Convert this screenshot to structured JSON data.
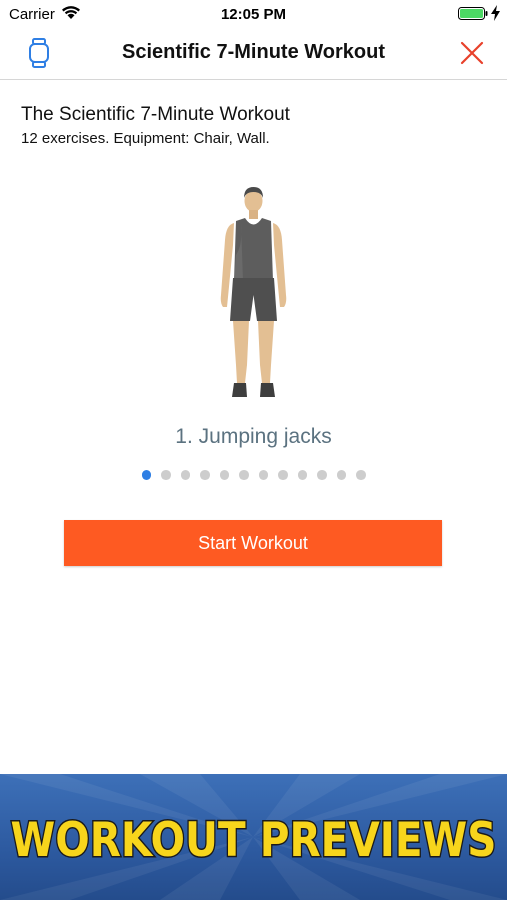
{
  "status_bar": {
    "carrier": "Carrier",
    "time": "12:05 PM"
  },
  "nav": {
    "title": "Scientific 7-Minute Workout",
    "accent_color": "#2f7fe4",
    "close_color": "#e8412b"
  },
  "workout": {
    "title": "The Scientific 7-Minute Workout",
    "subtitle": "12 exercises. Equipment: Chair, Wall."
  },
  "exercise": {
    "label": "1. Jumping jacks",
    "illustration": "standing-person-figure"
  },
  "pager": {
    "total": 12,
    "current": 1
  },
  "start_button": {
    "label": "Start Workout",
    "color": "#fe5a22"
  },
  "banner": {
    "text": "WORKOUT PREVIEWS",
    "text_color": "#f7d51c"
  }
}
